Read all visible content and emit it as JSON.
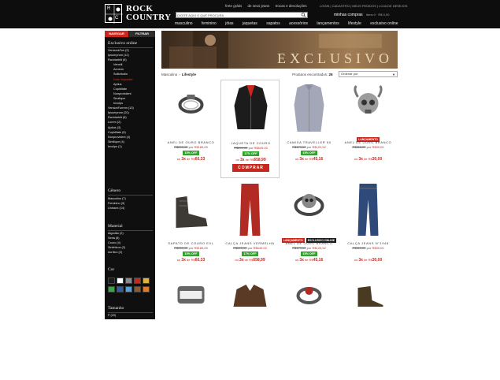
{
  "header": {
    "logo_letters": [
      "R",
      "C"
    ],
    "logo_line1": "ROCK",
    "logo_line2": "COUNTRY",
    "top_links": [
      "frete grátis",
      "de seus jeans",
      "trocas e devoluções"
    ],
    "search_placeholder": "DIGITE AQUI O QUE PROCURA",
    "account_links": "LOGIN | CADASTRO | MEUS PEDIDOS | LOJA DE DESEJOS",
    "cart_label": "minhas compras",
    "cart_total": "itens 0 · R$ 0,00",
    "nav": [
      "masculino",
      "feminino",
      "jóias",
      "jaquetas",
      "sapatos",
      "acessórios",
      "lançamentos",
      "lifestyle",
      "exclusivo online"
    ]
  },
  "sidebar": {
    "tab_active": "NAVEGAR",
    "tab_inactive": "FILTRAR",
    "section1_title": "Exclusivo online",
    "section1_items": [
      {
        "label": "VersionsFun (2)",
        "sub": false,
        "active": false
      },
      {
        "label": "Ipsumprom (12)",
        "sub": false,
        "active": false
      },
      {
        "label": "Ravidarbilt (8)",
        "sub": false,
        "active": false
      },
      {
        "label": "Venetil",
        "sub": true,
        "active": false
      },
      {
        "label": "Aeneon",
        "sub": true,
        "active": false
      },
      {
        "label": "Sollicitudin",
        "sub": true,
        "active": false
      },
      {
        "label": "Duis Vulputate",
        "sub": true,
        "active": true
      },
      {
        "label": "Aptius",
        "sub": true,
        "active": false
      },
      {
        "label": "Cupiditate",
        "sub": true,
        "active": false
      },
      {
        "label": "Nonprovident",
        "sub": true,
        "active": false
      },
      {
        "label": "Similiqve",
        "sub": true,
        "active": false
      },
      {
        "label": "Invulps",
        "sub": true,
        "active": false
      },
      {
        "label": "VersionFurrem (13)",
        "sub": false,
        "active": false
      },
      {
        "label": "Ipsumprom (20)",
        "sub": false,
        "active": false
      },
      {
        "label": "Ravidarbilt (8)",
        "sub": false,
        "active": false
      },
      {
        "label": "Lorem (2)",
        "sub": false,
        "active": false
      },
      {
        "label": "Aptius (3)",
        "sub": false,
        "active": false
      },
      {
        "label": "Cupiditate (6)",
        "sub": false,
        "active": false
      },
      {
        "label": "Nonprovident (4)",
        "sub": false,
        "active": false
      },
      {
        "label": "Similiqve (4)",
        "sub": false,
        "active": false
      },
      {
        "label": "Invulps (1)",
        "sub": false,
        "active": false
      }
    ],
    "section2_title": "Gênero",
    "section2_items": [
      "Masculino (7)",
      "Feminino (3)",
      "Unissex (14)"
    ],
    "section3_title": "Material",
    "section3_items": [
      "Algodão (2)",
      "Seda (8)",
      "Couro (4)",
      "Sintéticos (2)",
      "Acrílico (2)"
    ],
    "section4_title": "Cor",
    "swatch_colors": [
      "#1a1a1a",
      "#ffffff",
      "#8a8a8a",
      "#c9261d",
      "#d9b43a",
      "#3fa24a",
      "#2f5ea8",
      "#5a9fd4",
      "#8a5a2c",
      "#e07a2c"
    ],
    "section5_title": "Tamanho",
    "section5_items": [
      "P (29)"
    ]
  },
  "content": {
    "banner_text": "EXCLUSIVO",
    "breadcrumb_home": "Masculino",
    "breadcrumb_sep": "›",
    "breadcrumb_current": "Lifestyle",
    "results_label": "Produtos encontrados:",
    "results_count": "26",
    "sort_label": "Ordenar por"
  },
  "products": [
    {
      "name": "ANEL DE OURO BRANCO",
      "old": "R$200,00",
      "por": "por",
      "new": "R$189,00",
      "discount": "15% OFF",
      "inst_prefix": "ou",
      "inst_n": "3x",
      "inst_de": "de R$",
      "inst_val": "60,33",
      "badges": [],
      "buy": "",
      "icon": "ring"
    },
    {
      "name": "JAQUETA DE COURO",
      "old": "R$899,00",
      "por": "por",
      "new": "R$649,00",
      "discount": "17% OFF",
      "inst_prefix": "ou",
      "inst_n": "3x",
      "inst_de": "de R$",
      "inst_val": "658,99",
      "badges": [],
      "buy": "COMPRAR",
      "icon": "jacket"
    },
    {
      "name": "CAMISA TRAVELLER 50",
      "old": "R$179,00",
      "por": "por",
      "new": "R$120,52",
      "discount": "15% OFF",
      "inst_prefix": "ou",
      "inst_n": "3x",
      "inst_de": "de R$",
      "inst_val": "45,16",
      "badges": [],
      "buy": "",
      "icon": "shirt"
    },
    {
      "name": "ANEL DE OURO BRANCO",
      "old": "R$118,00",
      "por": "por",
      "new": "R$90,00",
      "discount": "",
      "inst_prefix": "ou",
      "inst_n": "3x",
      "inst_de": "de R$",
      "inst_val": "30,00",
      "badges": [
        {
          "text": "LANÇAMENTO",
          "color": "red"
        }
      ],
      "buy": "",
      "icon": "skull"
    },
    {
      "name": "SAPATO DE COURO EXL",
      "old": "R$250,00",
      "por": "por",
      "new": "R$189,00",
      "discount": "15% OFF",
      "inst_prefix": "ou",
      "inst_n": "3x",
      "inst_de": "de R$",
      "inst_val": "60,33",
      "badges": [],
      "buy": "",
      "icon": "boot"
    },
    {
      "name": "CALÇA JEANS VERMELHA",
      "old": "R$890,00",
      "por": "por",
      "new": "R$649,00",
      "discount": "17% OFF",
      "inst_prefix": "ou",
      "inst_n": "3x",
      "inst_de": "de R$",
      "inst_val": "658,99",
      "badges": [],
      "buy": "",
      "icon": "redpants"
    },
    {
      "name": "ANEL DE OURO BRANCO",
      "old": "R$179,00",
      "por": "por",
      "new": "R$126,52",
      "discount": "15% OFF",
      "inst_prefix": "ou",
      "inst_n": "3x",
      "inst_de": "de R$",
      "inst_val": "45,16",
      "badges": [
        {
          "text": "LANÇAMENTO",
          "color": "red"
        },
        {
          "text": "EXCLUSIVO ONLINE",
          "color": "black"
        }
      ],
      "buy": "",
      "icon": "skullring"
    },
    {
      "name": "CALÇA JEANS N°1948",
      "old": "R$110,00",
      "por": "por",
      "new": "R$90,00",
      "discount": "",
      "inst_prefix": "ou",
      "inst_n": "3x",
      "inst_de": "de R$",
      "inst_val": "30,00",
      "badges": [],
      "buy": "",
      "icon": "jeans"
    },
    {
      "name": "",
      "old": "",
      "por": "",
      "new": "",
      "discount": "",
      "inst_prefix": "",
      "inst_n": "",
      "inst_de": "",
      "inst_val": "",
      "badges": [],
      "buy": "",
      "icon": "band"
    },
    {
      "name": "",
      "old": "",
      "por": "",
      "new": "",
      "discount": "",
      "inst_prefix": "",
      "inst_n": "",
      "inst_de": "",
      "inst_val": "",
      "badges": [],
      "buy": "",
      "icon": "brownjacket"
    },
    {
      "name": "",
      "old": "",
      "por": "",
      "new": "",
      "discount": "",
      "inst_prefix": "",
      "inst_n": "",
      "inst_de": "",
      "inst_val": "",
      "badges": [],
      "buy": "",
      "icon": "redring"
    },
    {
      "name": "",
      "old": "",
      "por": "",
      "new": "",
      "discount": "",
      "inst_prefix": "",
      "inst_n": "",
      "inst_de": "",
      "inst_val": "",
      "badges": [],
      "buy": "",
      "icon": "boot2"
    }
  ]
}
